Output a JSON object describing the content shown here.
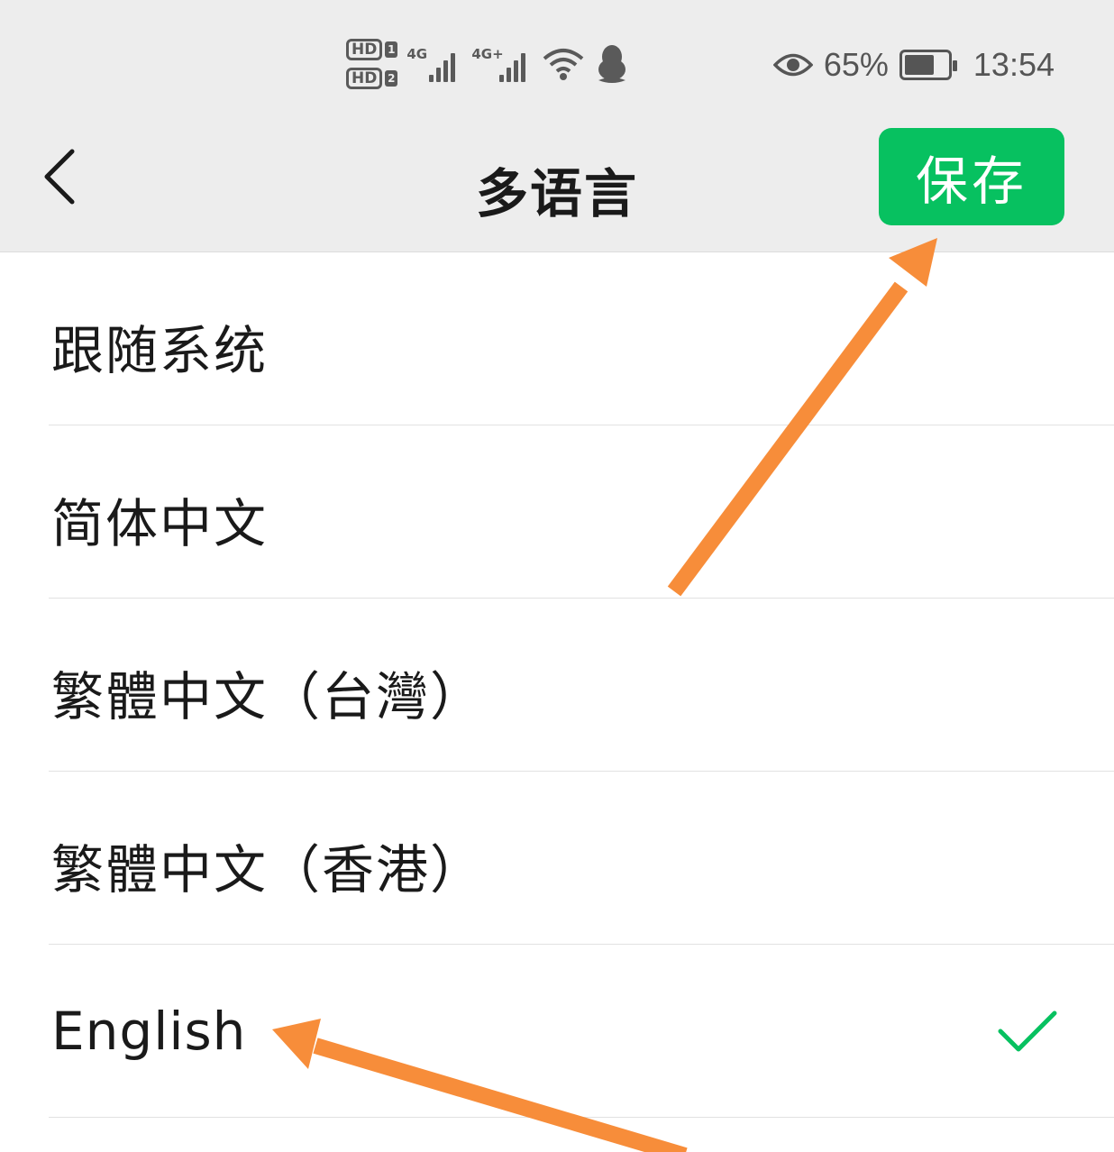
{
  "status_bar": {
    "hd1": "HD",
    "hd1_num": "1",
    "hd2": "HD",
    "hd2_num": "2",
    "net1": "4G",
    "net2": "4G+",
    "battery_percent": "65%",
    "time": "13:54",
    "icons": [
      "hd-icon",
      "signal-icon",
      "wifi-icon",
      "qq-penguin-icon",
      "eye-icon",
      "battery-icon"
    ]
  },
  "header": {
    "title": "多语言",
    "save_label": "保存",
    "save_color": "#07c160"
  },
  "languages": [
    {
      "label": "跟随系统",
      "selected": false
    },
    {
      "label": "简体中文",
      "selected": false
    },
    {
      "label": "繁體中文（台灣）",
      "selected": false
    },
    {
      "label": "繁體中文（香港）",
      "selected": false
    },
    {
      "label": "English",
      "selected": true
    }
  ],
  "colors": {
    "accent": "#07c160",
    "annotation_arrow": "#f78d3a",
    "bar_background": "#ededed"
  }
}
